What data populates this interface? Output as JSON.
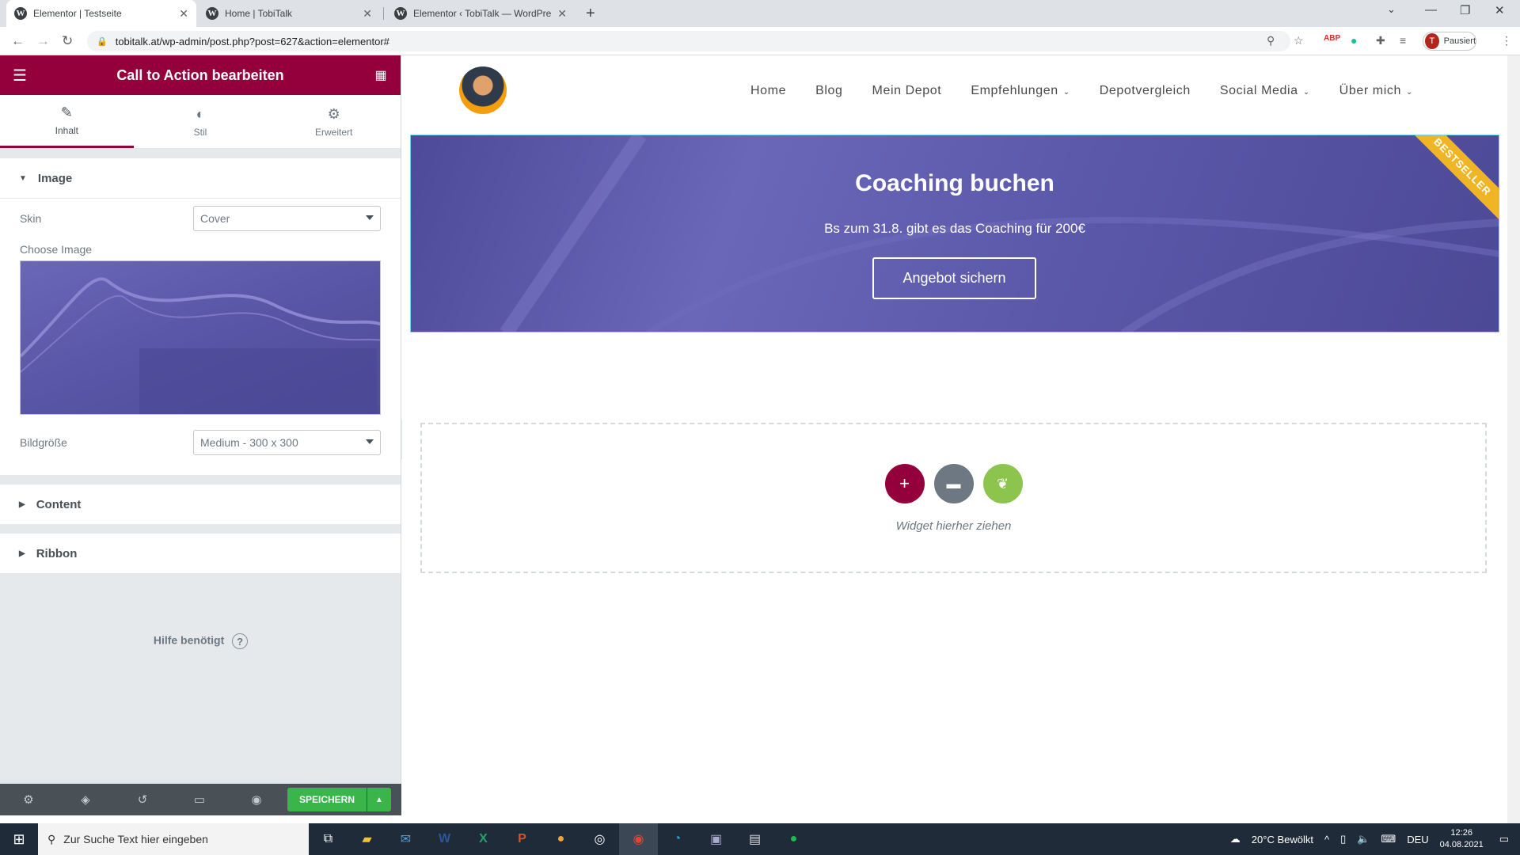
{
  "browser": {
    "tabs": [
      {
        "title": "Elementor | Testseite",
        "active": true
      },
      {
        "title": "Home | TobiTalk",
        "active": false
      },
      {
        "title": "Elementor ‹ TobiTalk — WordPre",
        "active": false
      }
    ],
    "url": "tobitalk.at/wp-admin/post.php?post=627&action=elementor#",
    "profile_initial": "T",
    "profile_label": "Pausiert"
  },
  "panel": {
    "title": "Call to Action bearbeiten",
    "tabs": [
      {
        "label": "Inhalt",
        "icon": "pencil-icon",
        "active": true
      },
      {
        "label": "Stil",
        "icon": "contrast-icon",
        "active": false
      },
      {
        "label": "Erweitert",
        "icon": "gear-icon",
        "active": false
      }
    ],
    "image_section": {
      "title": "Image",
      "skin_label": "Skin",
      "skin_value": "Cover",
      "choose_image_label": "Choose Image",
      "bildgroesse_label": "Bildgröße",
      "bildgroesse_value": "Medium - 300 x 300"
    },
    "content_section": "Content",
    "ribbon_section": "Ribbon",
    "help_text": "Hilfe benötigt",
    "save_label": "SPEICHERN"
  },
  "site": {
    "menu": [
      "Home",
      "Blog",
      "Mein Depot",
      "Empfehlungen",
      "Depotvergleich",
      "Social Media",
      "Über mich"
    ],
    "menu_dropdowns": [
      false,
      false,
      false,
      true,
      false,
      true,
      true
    ],
    "cta": {
      "title": "Coaching buchen",
      "description": "Bs zum 31.8. gibt es das Coaching für 200€",
      "button": "Angebot sichern",
      "ribbon": "BESTSELLER"
    },
    "dropzone_label": "Widget hierher ziehen"
  },
  "taskbar": {
    "search_placeholder": "Zur Suche Text hier eingeben",
    "weather": "20°C Bewölkt",
    "lang": "DEU",
    "time": "12:26",
    "date": "04.08.2021"
  },
  "colors": {
    "elementor_brand": "#93003c",
    "save_green": "#39b54a",
    "ribbon_yellow": "#f0b524",
    "cta_overlay": "#5b58aa"
  }
}
